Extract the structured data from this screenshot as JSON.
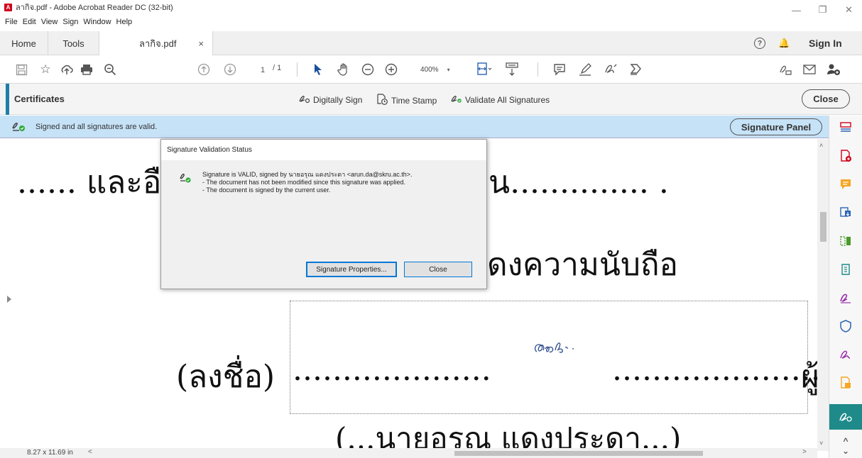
{
  "window": {
    "title": "ลากิจ.pdf - Adobe Acrobat Reader DC (32-bit)",
    "app_icon": "A",
    "controls": [
      "—",
      "❐",
      "✕"
    ]
  },
  "menu": [
    "File",
    "Edit",
    "View",
    "Sign",
    "Window",
    "Help"
  ],
  "tabs": {
    "home": "Home",
    "tools": "Tools",
    "doc": "ลากิจ.pdf",
    "doc_close": "×",
    "help": "?",
    "bell": "🔔",
    "sign_in": "Sign In"
  },
  "toolbar": {
    "page_current": "1",
    "page_total": "/ 1",
    "zoom": "400%",
    "zoom_caret": "▾",
    "icons": [
      "save-icon",
      "bookmark-star-icon",
      "share-upload-icon",
      "print-icon",
      "zoom-search-icon",
      "page-up-icon",
      "page-down-icon",
      "select-pointer-icon",
      "hand-icon",
      "zoom-out-icon",
      "zoom-in-icon",
      "fit-page-icon",
      "scroll-mode-icon",
      "comment-icon",
      "highlight-pen-icon",
      "fill-sign-icon",
      "stamp-icon",
      "sign-share-icon",
      "email-icon",
      "add-user-icon"
    ]
  },
  "certificates": {
    "title": "Certificates",
    "digitally_sign": "Digitally Sign",
    "time_stamp": "Time Stamp",
    "validate_all": "Validate All Signatures",
    "close": "Close"
  },
  "signature_bar": {
    "status": "Signed and all signatures are valid.",
    "panel_button": "Signature Panel"
  },
  "document": {
    "line1_left": "...... และอื",
    "line1_right": "น.............. .",
    "line2": "ดงความนับถือ",
    "sign_label": "(ลงชื่อ)",
    "sign_dots_left": "....................",
    "sign_dots_right": ".....................",
    "sign_trail": "ผู้",
    "name_line": "(...นายอรุณ แดงประดา...)",
    "page_size": "8.27 x 11.69 in"
  },
  "dialog": {
    "title": "Signature Validation Status",
    "line1": "Signature is VALID, signed by นายอรุณ แดงประดา <arun.da@skru.ac.th>.",
    "line2": "- The document has not been modified since this signature was applied.",
    "line3": "- The document is signed by the current user.",
    "properties_button": "Signature Properties...",
    "close_button": "Close"
  },
  "scroll": {
    "up": "˄",
    "down": "˅",
    "left": "<",
    "right": ">",
    "expand_left": "›"
  },
  "right_rail": {
    "colors": {
      "export": "#d0021b",
      "comment": "#f5a623",
      "organize": "#2b63b5",
      "edit": "#4a9a2a",
      "protect": "#2b63b5",
      "fill_sign": "#9b2fae",
      "active_bg": "#1f8a8a"
    },
    "up": "^",
    "down": "⌄"
  },
  "colors": {
    "accent": "#1f7ea8",
    "sig_bar_bg": "#c6e2f7",
    "valid_green": "#2eaa3b",
    "signature_ink": "#2a4a8a"
  }
}
